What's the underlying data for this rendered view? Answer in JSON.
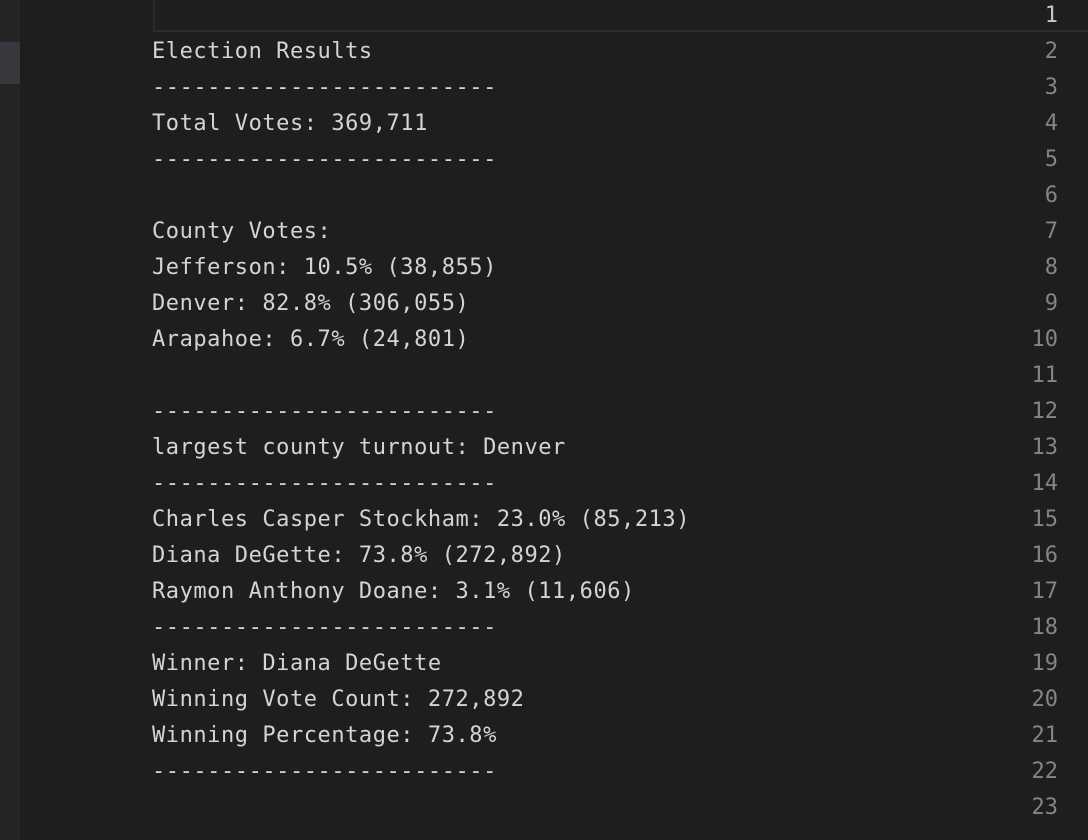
{
  "editor": {
    "active_line": "1",
    "lines": [
      {
        "number": "1",
        "text": ""
      },
      {
        "number": "2",
        "text": "Election Results"
      },
      {
        "number": "3",
        "text": "-------------------------"
      },
      {
        "number": "4",
        "text": "Total Votes: 369,711"
      },
      {
        "number": "5",
        "text": "-------------------------"
      },
      {
        "number": "6",
        "text": ""
      },
      {
        "number": "7",
        "text": "County Votes:"
      },
      {
        "number": "8",
        "text": "Jefferson: 10.5% (38,855)"
      },
      {
        "number": "9",
        "text": "Denver: 82.8% (306,055)"
      },
      {
        "number": "10",
        "text": "Arapahoe: 6.7% (24,801)"
      },
      {
        "number": "11",
        "text": ""
      },
      {
        "number": "12",
        "text": "-------------------------"
      },
      {
        "number": "13",
        "text": "largest county turnout: Denver"
      },
      {
        "number": "14",
        "text": "-------------------------"
      },
      {
        "number": "15",
        "text": "Charles Casper Stockham: 23.0% (85,213)"
      },
      {
        "number": "16",
        "text": "Diana DeGette: 73.8% (272,892)"
      },
      {
        "number": "17",
        "text": "Raymon Anthony Doane: 3.1% (11,606)"
      },
      {
        "number": "18",
        "text": "-------------------------"
      },
      {
        "number": "19",
        "text": "Winner: Diana DeGette"
      },
      {
        "number": "20",
        "text": "Winning Vote Count: 272,892"
      },
      {
        "number": "21",
        "text": "Winning Percentage: 73.8%"
      },
      {
        "number": "22",
        "text": "-------------------------"
      },
      {
        "number": "23",
        "text": ""
      }
    ]
  },
  "colors": {
    "background": "#1e1e1e",
    "text": "#d4d4d4",
    "line_number": "#858585",
    "active_line_number": "#c6c6c6"
  }
}
